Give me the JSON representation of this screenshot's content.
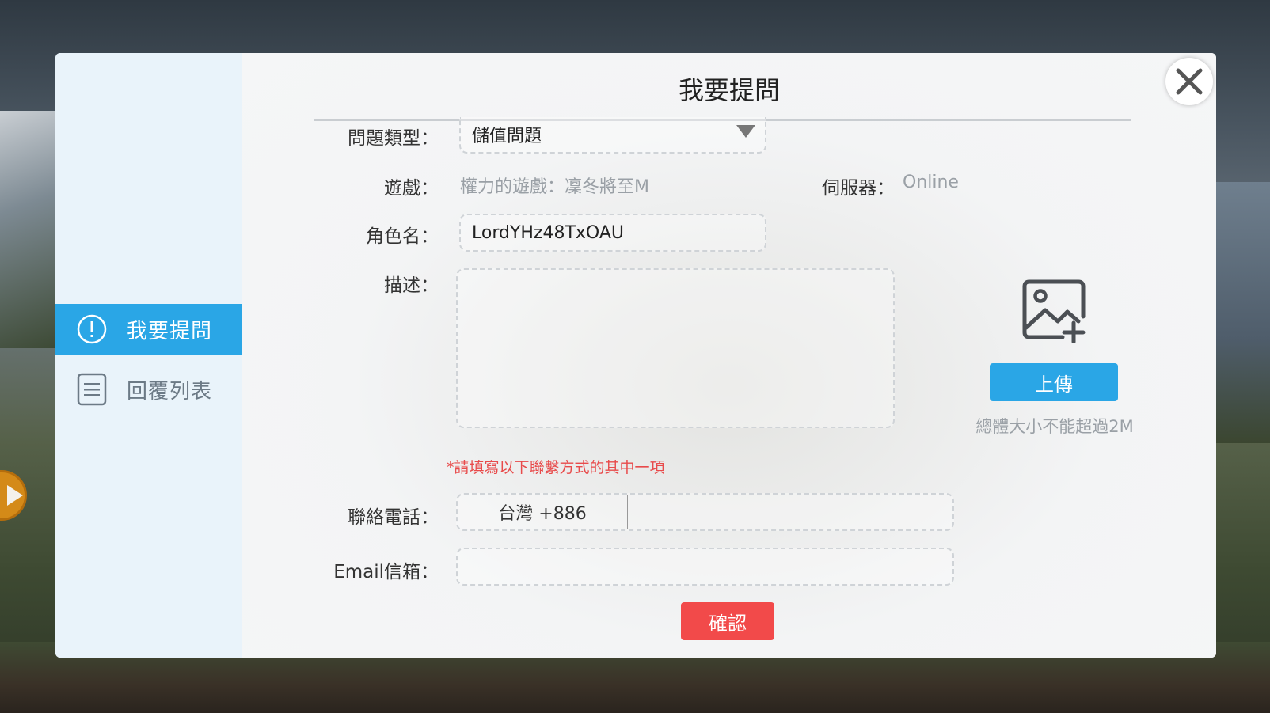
{
  "sidebar": {
    "items": [
      {
        "label": "我要提問",
        "icon": "exclamation-circle-icon",
        "active": true
      },
      {
        "label": "回覆列表",
        "icon": "list-document-icon",
        "active": false
      }
    ]
  },
  "dialog": {
    "title": "我要提問"
  },
  "form": {
    "question_type": {
      "label": "問題類型：",
      "value": "儲值問題"
    },
    "game": {
      "label": "遊戲：",
      "value": "權力的遊戲：凜冬將至M"
    },
    "server": {
      "label": "伺服器：",
      "value": "Online"
    },
    "character": {
      "label": "角色名：",
      "value": "LordYHz48TxOAU"
    },
    "description": {
      "label": "描述：",
      "value": ""
    },
    "upload": {
      "button": "上傳",
      "note": "總體大小不能超過2M",
      "icon": "add-image-icon"
    },
    "contact_note": "*請填寫以下聯繫方式的其中一項",
    "phone": {
      "label": "聯絡電話：",
      "country": "台灣 +886",
      "value": ""
    },
    "email": {
      "label": "Email信箱：",
      "value": ""
    },
    "confirm": "確認"
  },
  "colors": {
    "accent": "#2aa6e6",
    "danger": "#f24a4a",
    "note_red": "#e84b4b"
  }
}
